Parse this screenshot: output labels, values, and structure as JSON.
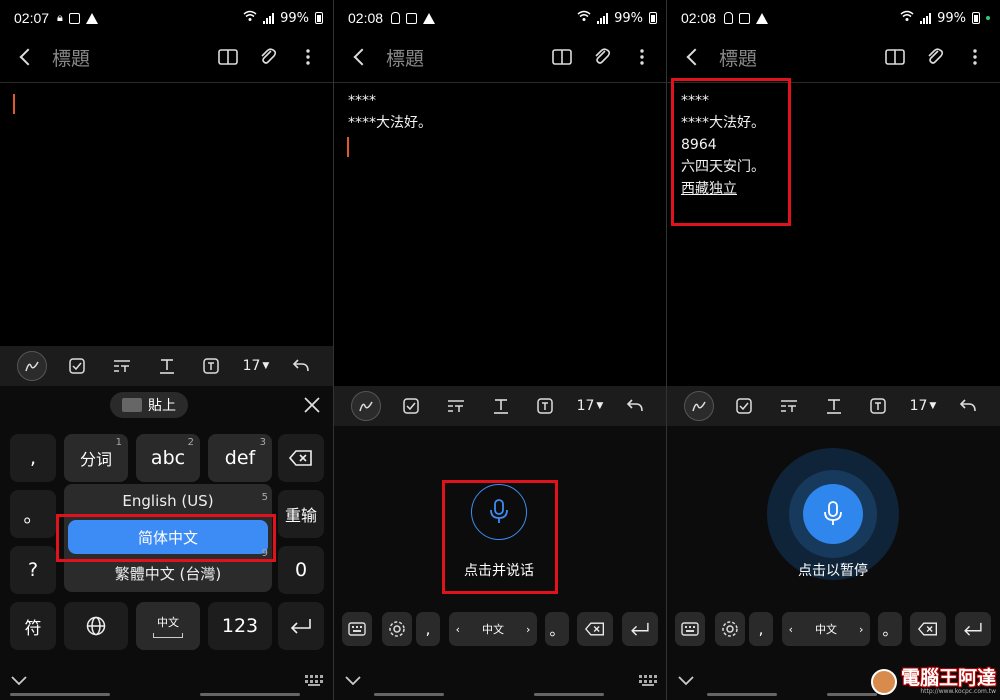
{
  "panels": [
    {
      "status": {
        "time": "02:07",
        "battery": "99%"
      },
      "title": "標題",
      "toolbar": {
        "font_size": "17"
      },
      "clipboard": {
        "paste_label": "貼上"
      },
      "keys": {
        "comma": ",",
        "period": "。",
        "question": "?",
        "symbols": "符",
        "seg": "分词",
        "abc": "abc",
        "def": "def",
        "enter_cn": "重输",
        "zero": "0",
        "num": "123",
        "space_label": "中文",
        "sup1": "1",
        "sup2": "2",
        "sup3": "3",
        "sup5": "5",
        "sup9": "9"
      },
      "lang_popup": {
        "options": [
          "English (US)",
          "简体中文",
          "繁體中文 (台灣)"
        ],
        "selected": "简体中文"
      }
    },
    {
      "status": {
        "time": "02:08",
        "battery": "99%"
      },
      "title": "標題",
      "note_lines": [
        "****",
        "****大法好。"
      ],
      "toolbar": {
        "font_size": "17"
      },
      "voice": {
        "prompt": "点击并说话"
      },
      "bottom": {
        "lang": "中文",
        "comma": ",",
        "period": "。"
      }
    },
    {
      "status": {
        "time": "02:08",
        "battery": "99%"
      },
      "title": "標題",
      "note_lines": [
        "****",
        "****大法好。",
        "8964",
        "六四天安门。",
        "西藏独立"
      ],
      "toolbar": {
        "font_size": "17"
      },
      "voice": {
        "prompt": "点击以暂停"
      },
      "bottom": {
        "lang": "中文",
        "comma": ",",
        "period": "。"
      }
    }
  ],
  "colors": {
    "accent_blue": "#3d8cf5",
    "highlight_red": "#e0121b",
    "caret": "#e05a2a"
  },
  "watermark": {
    "brand": "電腦王阿達",
    "url": "http://www.kocpc.com.tw"
  }
}
